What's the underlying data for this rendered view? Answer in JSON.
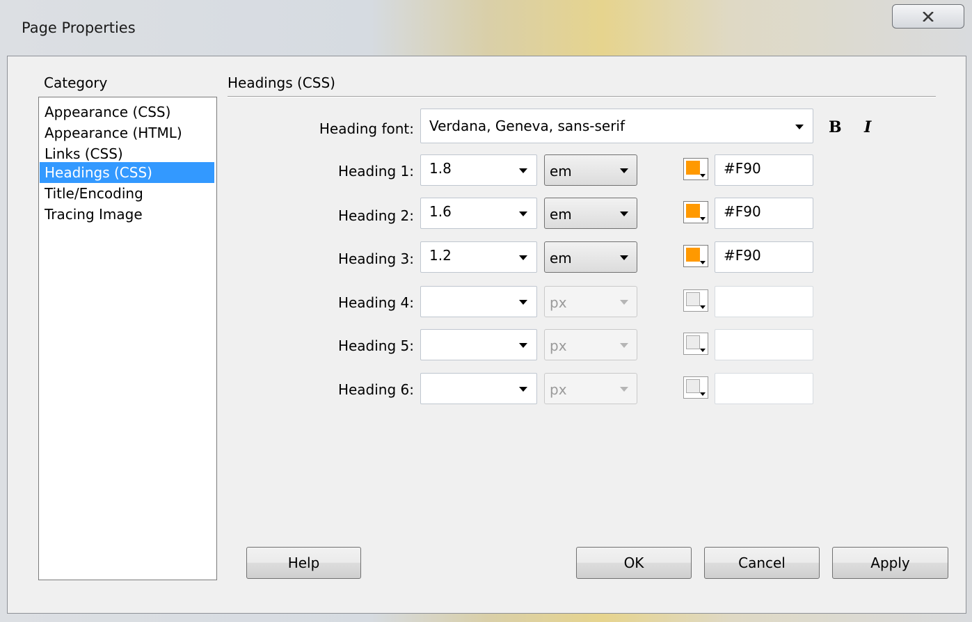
{
  "window": {
    "title": "Page Properties",
    "close_glyph": "X"
  },
  "category": {
    "label": "Category",
    "items": [
      {
        "label": "Appearance (CSS)"
      },
      {
        "label": "Appearance (HTML)"
      },
      {
        "label": "Links (CSS)"
      },
      {
        "label": "Headings (CSS)",
        "selected": true
      },
      {
        "label": "Title/Encoding"
      },
      {
        "label": "Tracing Image"
      }
    ]
  },
  "section": {
    "title": "Headings (CSS)"
  },
  "heading_font": {
    "label": "Heading font:",
    "value": "Verdana, Geneva, sans-serif",
    "bold_glyph": "B",
    "italic_glyph": "I"
  },
  "headings": [
    {
      "label": "Heading 1:",
      "size": "1.8",
      "unit": "em",
      "color_text": "#F90",
      "color": "#ff9900",
      "enabled": true
    },
    {
      "label": "Heading 2:",
      "size": "1.6",
      "unit": "em",
      "color_text": "#F90",
      "color": "#ff9900",
      "enabled": true
    },
    {
      "label": "Heading 3:",
      "size": "1.2",
      "unit": "em",
      "color_text": "#F90",
      "color": "#ff9900",
      "enabled": true
    },
    {
      "label": "Heading 4:",
      "size": "",
      "unit": "px",
      "color_text": "",
      "enabled": false
    },
    {
      "label": "Heading 5:",
      "size": "",
      "unit": "px",
      "color_text": "",
      "enabled": false
    },
    {
      "label": "Heading 6:",
      "size": "",
      "unit": "px",
      "color_text": "",
      "enabled": false
    }
  ],
  "buttons": {
    "help": "Help",
    "ok": "OK",
    "cancel": "Cancel",
    "apply": "Apply"
  }
}
